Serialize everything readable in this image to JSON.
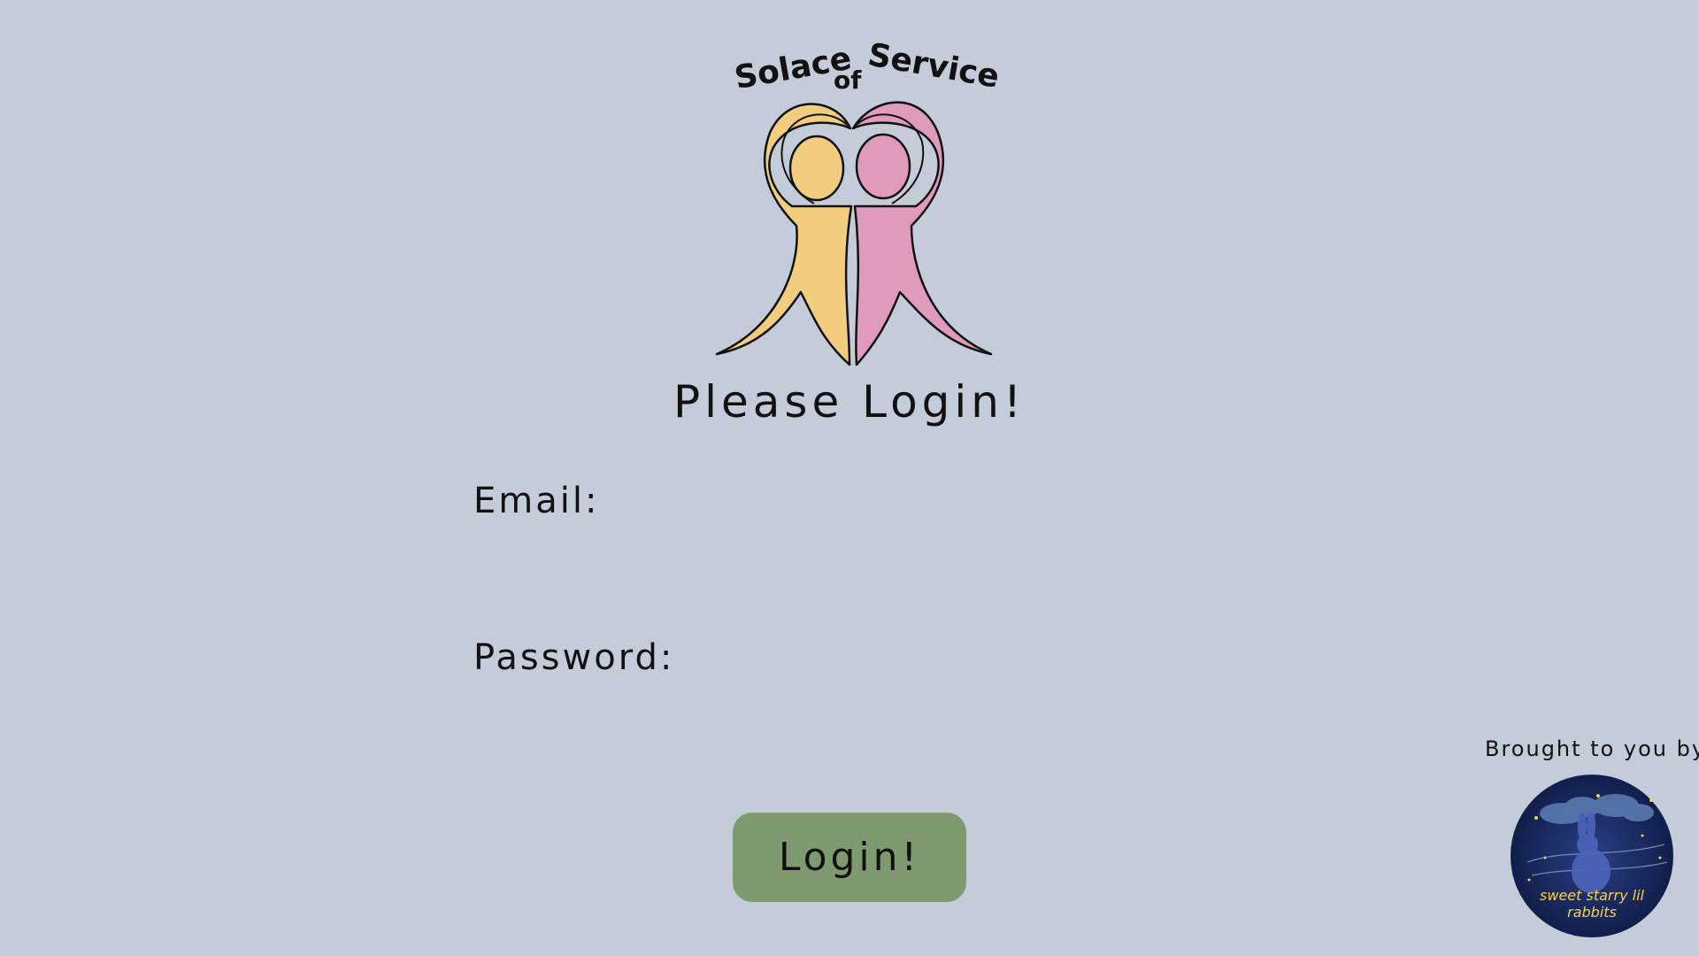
{
  "logo": {
    "text_left": "Solace",
    "text_mid": "of",
    "text_right": "Service",
    "colors": {
      "left": "#f2cd7e",
      "right": "#e09abb",
      "outline": "#111111"
    }
  },
  "heading": "Please Login!",
  "form": {
    "email_label": "Email:",
    "email_value": "",
    "password_label": "Password:",
    "password_value": "",
    "submit_label": "Login!"
  },
  "footer": {
    "credit_label": "Brought to you by:",
    "badge_text_line1": "sweet starry lil",
    "badge_text_line2": "rabbits"
  },
  "colors": {
    "background": "#c5ccd9",
    "button": "#7f9a70",
    "badge_bg": "#14224f",
    "badge_text": "#f5d44a"
  }
}
